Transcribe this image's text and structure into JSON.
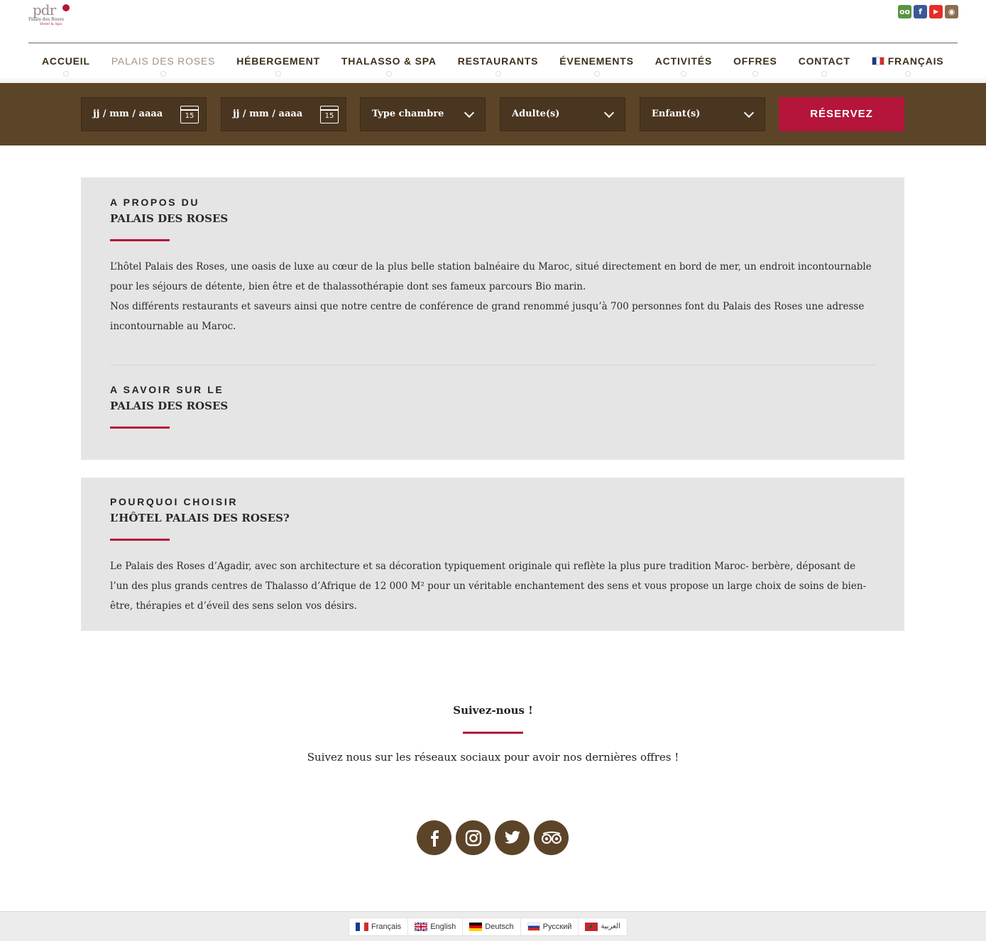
{
  "brand": {
    "logo_mark": "pdr",
    "logo_sub": "Palais des Roses",
    "logo_sub2": "Hotel & Spa"
  },
  "social_top": [
    {
      "name": "tripadvisor",
      "glyph": "oo",
      "color": "#589442"
    },
    {
      "name": "facebook",
      "glyph": "f",
      "color": "#3b5998"
    },
    {
      "name": "youtube",
      "glyph": "▶",
      "color": "#e52d27"
    },
    {
      "name": "instagram",
      "glyph": "◉",
      "color": "#8a6d4e"
    }
  ],
  "nav": {
    "items": [
      "ACCUEIL",
      "PALAIS DES ROSES",
      "HÉBERGEMENT",
      "THALASSO & SPA",
      "RESTAURANTS",
      "ÉVENEMENTS",
      "ACTIVITÉS",
      "OFFRES",
      "CONTACT"
    ],
    "language": "FRANÇAIS"
  },
  "booking": {
    "arrival_placeholder": "jj / mm / aaaa",
    "departure_placeholder": "jj / mm / aaaa",
    "calendar_day": "15",
    "room_type": "Type chambre",
    "adults": "Adulte(s)",
    "children": "Enfant(s)",
    "reserve_label": "RÉSERVEZ"
  },
  "about": {
    "kicker": "A PROPOS DU",
    "title": "PALAIS DES ROSES",
    "p1": "L’hôtel Palais des Roses, une oasis de luxe au cœur de la plus belle station balnéaire du Maroc, situé directement en bord de mer, un endroit incontournable pour les séjours de détente, bien être et de thalassothérapie dont ses fameux parcours Bio marin.",
    "p2": "Nos différents restaurants et saveurs ainsi que notre centre de conférence de grand renommé jusqu’à 700 personnes font du Palais des Roses une adresse incontournable au Maroc."
  },
  "know": {
    "kicker": "A SAVOIR SUR LE",
    "title": "PALAIS DES ROSES"
  },
  "why": {
    "kicker": "POURQUOI CHOISIR",
    "title": "L’HÔTEL PALAIS DES ROSES?",
    "p1": "Le Palais des Roses d’Agadir, avec son architecture et sa décoration typiquement originale qui reflète la plus pure tradition Maroc- berbère, déposant de l’un des plus grands centres de Thalasso d’Afrique de 12 000 M² pour un véritable enchantement des sens et vous propose un large choix de soins de bien-être, thérapies et d’éveil des sens selon vos désirs."
  },
  "follow": {
    "title": "Suivez-nous !",
    "text": "Suivez nous sur les réseaux sociaux pour avoir nos dernières offres !",
    "networks": [
      "facebook",
      "instagram",
      "twitter",
      "tripadvisor"
    ]
  },
  "languages": [
    {
      "label": "Français",
      "flag": "fr"
    },
    {
      "label": "English",
      "flag": "gb"
    },
    {
      "label": "Deutsch",
      "flag": "de"
    },
    {
      "label": "Русский",
      "flag": "ru"
    },
    {
      "label": "العربية",
      "flag": "ma"
    }
  ]
}
